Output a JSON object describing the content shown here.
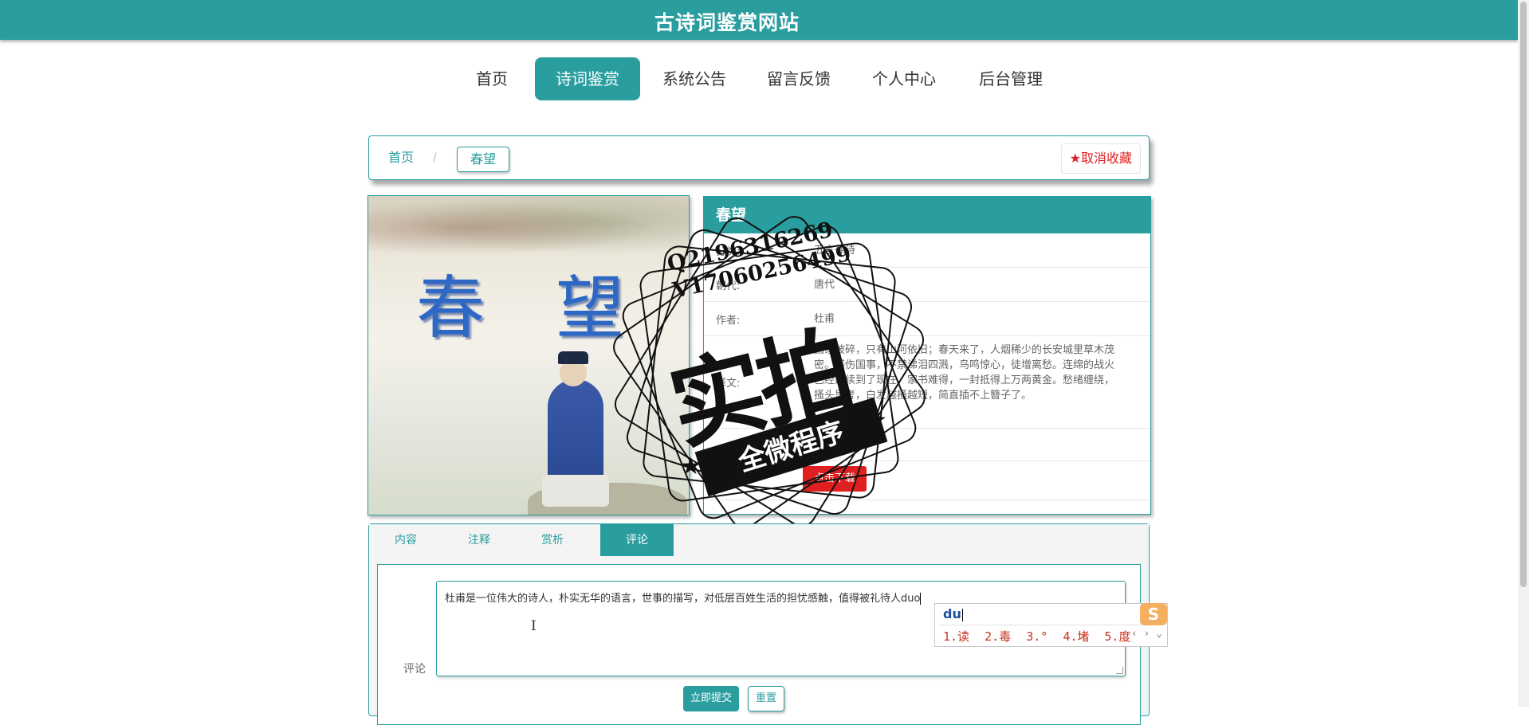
{
  "site": {
    "title": "古诗词鉴赏网站"
  },
  "nav": {
    "items": [
      {
        "label": "首页",
        "active": false
      },
      {
        "label": "诗词鉴赏",
        "active": true
      },
      {
        "label": "系统公告",
        "active": false
      },
      {
        "label": "留言反馈",
        "active": false
      },
      {
        "label": "个人中心",
        "active": false
      },
      {
        "label": "后台管理",
        "active": false
      }
    ]
  },
  "breadcrumb": {
    "home": "首页",
    "separator": "/",
    "current": "春望"
  },
  "favorite": {
    "icon": "star-icon",
    "label": "取消收藏"
  },
  "poem_image": {
    "chars": [
      "春",
      "望"
    ]
  },
  "detail": {
    "title": "春望",
    "rows": [
      {
        "label": "分类:",
        "value": "五言律诗"
      },
      {
        "label": "朝代:",
        "value": "唐代"
      },
      {
        "label": "作者:",
        "value": "杜甫"
      },
      {
        "label": "译文:",
        "value": "国家破碎，只有山河依旧；春天来了，人烟稀少的长安城里草木茂密。感伤国事，不禁涕泪四溅，鸟鸣惊心，徒增离愁。连绵的战火已经延续到了现在，家书难得，一封抵得上万两黄金。愁绪缠绕，搔头思考，白发越搔越短，简直插不上簪子了。"
      },
      {
        "label": "",
        "value": ""
      },
      {
        "label": "诗词:",
        "value": ""
      }
    ],
    "download_label": "点击下载"
  },
  "watermark": {
    "line1": "Q2196316269",
    "line2": "V17060256499",
    "big": "实拍",
    "banner": "全微程序"
  },
  "tabs": {
    "items": [
      {
        "label": "内容",
        "active": false
      },
      {
        "label": "注释",
        "active": false
      },
      {
        "label": "赏析",
        "active": false
      },
      {
        "label": "评论",
        "active": true
      }
    ]
  },
  "comment": {
    "label": "评论",
    "value": "杜甫是一位伟大的诗人，朴实无华的语言，世事的描写，对低层百姓生活的担忧感触，值得被礼待人duo",
    "submit_label": "立即提交",
    "reset_label": "重置"
  },
  "ime": {
    "input": "du",
    "candidates": [
      "1.读",
      "2.毒",
      "3.°",
      "4.堵",
      "5.度"
    ],
    "nav": "‹ › ⌄",
    "logo": "S"
  },
  "colors": {
    "accent": "#2a9d9f",
    "danger": "#e02020"
  }
}
